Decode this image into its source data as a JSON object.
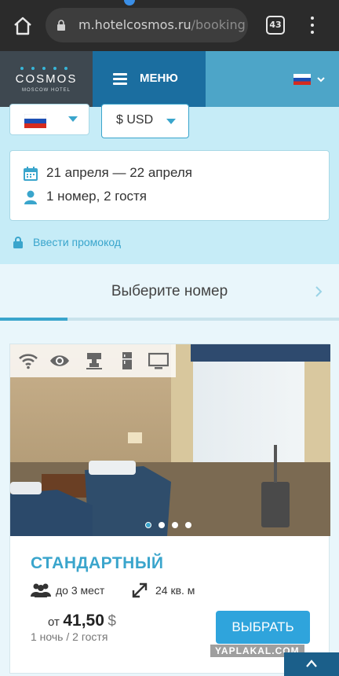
{
  "browser": {
    "url_main": "m.hotelcosmos.ru",
    "url_rest": "/booking",
    "tab_count": "43"
  },
  "header": {
    "logo_title": "COSMOS",
    "logo_subtitle": "MOSCOW HOTEL",
    "menu_label": "МЕНЮ",
    "language": "ru"
  },
  "filters": {
    "currency": "$ USD",
    "dates": "21 апреля — 22 апреля",
    "guests": "1 номер, 2 гостя",
    "promo_label": "Ввести промокод"
  },
  "step": {
    "title": "Выберите номер",
    "progress": 0.2
  },
  "room": {
    "name": "СТАНДАРТНЫЙ",
    "capacity": "до 3 мест",
    "area": "24 кв. м",
    "price_prefix": "от",
    "price": "41,50",
    "price_currency": "$",
    "nights_guests": "1 ночь / 2 гостя",
    "choose_label": "ВЫБРАТЬ",
    "amenity_icons": [
      "wifi-icon",
      "view-icon",
      "coffee-machine-icon",
      "fridge-icon",
      "tv-icon"
    ],
    "carousel_total": 4,
    "carousel_active": 0
  },
  "colors": {
    "accent": "#3aa5cc",
    "menu": "#1b6ea0",
    "header": "#4da5c8",
    "filter_bg": "#c6ecf7"
  },
  "watermark": "YAPLAKAL.COM"
}
